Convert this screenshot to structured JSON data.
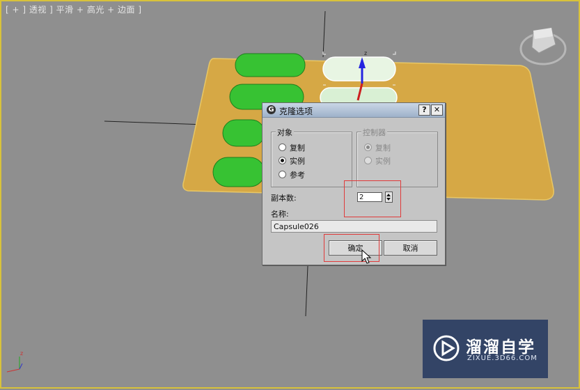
{
  "viewport": {
    "label": "[ + ] 透视 ] 平滑 + 高光 + 边面 ]",
    "axis_z_label": "z",
    "gizmo_z_label": "z",
    "border_color": "#d8c23a"
  },
  "dialog": {
    "title": "克隆选项",
    "app_icon": "G",
    "help_label": "?",
    "close_label": "✕",
    "object_group": {
      "title": "对象",
      "options": [
        {
          "label": "复制",
          "checked": false
        },
        {
          "label": "实例",
          "checked": true
        },
        {
          "label": "参考",
          "checked": false
        }
      ]
    },
    "controller_group": {
      "title": "控制器",
      "options": [
        {
          "label": "复制",
          "checked": true,
          "disabled": true
        },
        {
          "label": "实例",
          "checked": false,
          "disabled": true
        }
      ]
    },
    "copies_label": "副本数:",
    "copies_value": "2",
    "name_label": "名称:",
    "name_value": "Capsule026",
    "ok_label": "确定",
    "cancel_label": "取消"
  },
  "watermark": {
    "name": "溜溜自学",
    "url": "ZIXUE.3D66.COM"
  },
  "colors": {
    "plate": "#d6a845",
    "capsule": "#37c233",
    "highlight": "#e03a3a"
  }
}
